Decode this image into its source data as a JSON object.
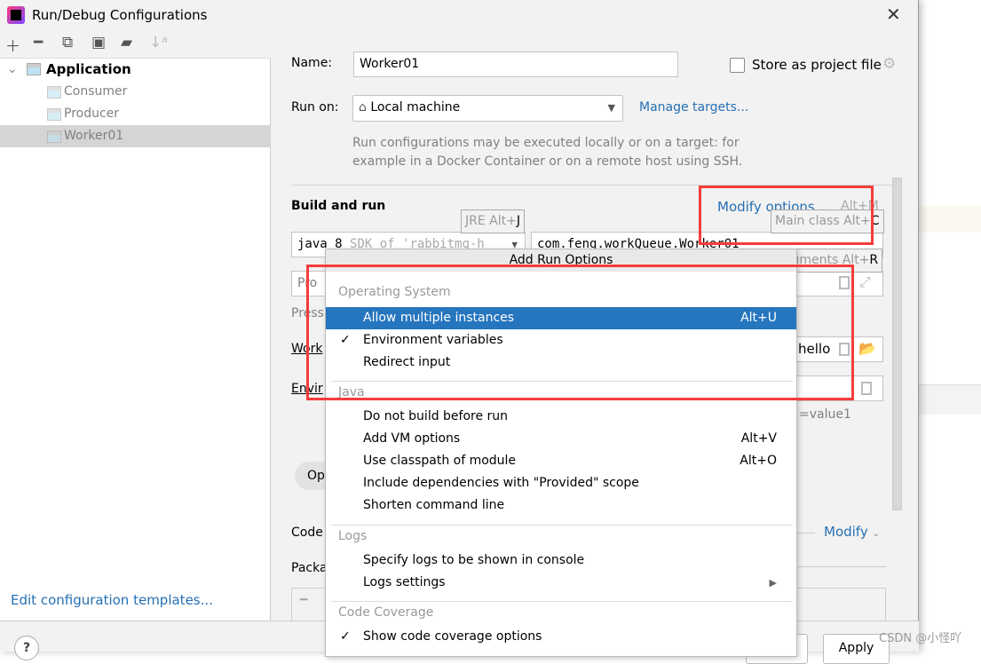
{
  "window": {
    "title": "Run/Debug Configurations"
  },
  "toolbar": {
    "icons": [
      "plus-icon",
      "minus-icon",
      "copy-icon",
      "save-icon",
      "new-folder-icon",
      "sort-icon"
    ]
  },
  "tree": {
    "root": "Application",
    "items": [
      "Consumer",
      "Producer",
      "Worker01"
    ],
    "selected": "Worker01"
  },
  "left_footer": {
    "edit_templates": "Edit configuration templates..."
  },
  "form": {
    "name_label": "Name:",
    "name_value": "Worker01",
    "store_label": "Store as project file",
    "store_checked": false,
    "run_on_label": "Run on:",
    "run_on_value": "Local machine",
    "manage_targets": "Manage targets...",
    "hint_line1": "Run configurations may be executed locally or on a target: for",
    "hint_line2": "example in a Docker Container or on a remote host using SSH.",
    "build_run": "Build and run",
    "modify_options": "Modify options",
    "modify_shortcut": "Alt+M",
    "jre_value": "java 8",
    "jre_hint": "SDK of 'rabbitmq-h",
    "main_class_value": "com.feng.workQueue.Worker01",
    "program_args_placeholder": "Pro",
    "press_text": "Press",
    "working_dir_label": "Work",
    "working_dir_value": "hello",
    "env_label": "Envir",
    "env_hint": "=value1",
    "open_pill": "Op",
    "code_label": "Code",
    "modify_link": "Modify",
    "packages_label": "Packa",
    "apply": "Apply"
  },
  "tooltips": {
    "jre": {
      "text": "JRE Alt+",
      "key": "J"
    },
    "main_class": {
      "text": "Main class Alt+",
      "key": "C"
    },
    "program_args": {
      "text": "Program arguments Alt+",
      "key": "R"
    }
  },
  "popup": {
    "title": "Add Run Options",
    "sections": [
      {
        "header": "Operating System",
        "items": [
          {
            "label": "Allow multiple instances",
            "shortcut": "Alt+U",
            "selected": true
          },
          {
            "label": "Environment variables",
            "checked": true
          },
          {
            "label": "Redirect input"
          }
        ]
      },
      {
        "header": "Java",
        "items": [
          {
            "label": "Do not build before run"
          },
          {
            "label": "Add VM options",
            "shortcut": "Alt+V"
          },
          {
            "label": "Use classpath of module",
            "shortcut": "Alt+O"
          },
          {
            "label": "Include dependencies with \"Provided\" scope"
          },
          {
            "label": "Shorten command line"
          }
        ]
      },
      {
        "header": "Logs",
        "items": [
          {
            "label": "Specify logs to be shown in console"
          },
          {
            "label": "Logs settings",
            "submenu": true
          }
        ]
      },
      {
        "header": "Code Coverage",
        "items": [
          {
            "label": "Show code coverage options",
            "checked": true
          }
        ]
      }
    ]
  },
  "colors": {
    "selection": "#2675bf",
    "link": "#2470b3",
    "annotation": "#f53c3c"
  },
  "watermark": "CSDN @小怪吖"
}
